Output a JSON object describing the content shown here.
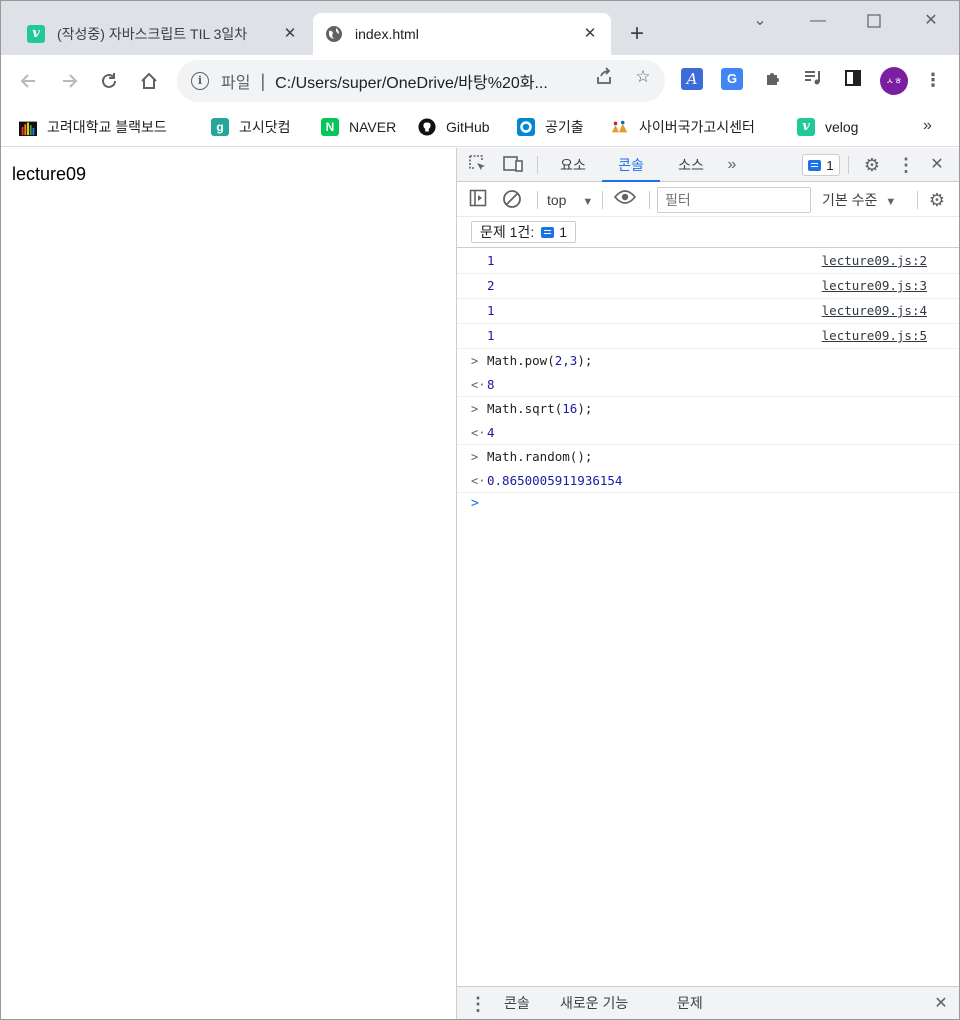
{
  "browser": {
    "tabs": [
      {
        "title": "(작성중) 자바스크립트 TIL 3일차",
        "favicon": "velog-icon",
        "active": false
      },
      {
        "title": "index.html",
        "favicon": "globe-icon",
        "active": true
      }
    ],
    "omnibox": {
      "scheme_label": "파일",
      "url": "C:/Users/super/OneDrive/바탕%20화..."
    },
    "avatar_text": "ㅅㅎ",
    "bookmarks": [
      {
        "label": "고려대학교 블랙보드",
        "icon": "bars-icon"
      },
      {
        "label": "고시닷컴",
        "icon": "g-icon"
      },
      {
        "label": "NAVER",
        "icon": "naver-icon"
      },
      {
        "label": "GitHub",
        "icon": "github-icon"
      },
      {
        "label": "공기출",
        "icon": "ring-icon"
      },
      {
        "label": "사이버국가고시센터",
        "icon": "flag-icon"
      },
      {
        "label": "velog",
        "icon": "velog-icon"
      }
    ],
    "bookmarks_more": "»"
  },
  "page": {
    "heading": "lecture09"
  },
  "devtools": {
    "tabs": [
      {
        "label": "요소",
        "active": false
      },
      {
        "label": "콘솔",
        "active": true
      },
      {
        "label": "소스",
        "active": false
      }
    ],
    "issue_count": "1",
    "context": "top",
    "filter_placeholder": "필터",
    "level": "기본 수준",
    "issues_label": "문제 1건:",
    "issues_count": "1",
    "logs": [
      {
        "value": "1",
        "source": "lecture09.js:2"
      },
      {
        "value": "2",
        "source": "lecture09.js:3"
      },
      {
        "value": "1",
        "source": "lecture09.js:4"
      },
      {
        "value": "1",
        "source": "lecture09.js:5"
      }
    ],
    "evaluations": [
      {
        "fn": "Math.pow(",
        "args": "2,3",
        "close": ");",
        "result": "8"
      },
      {
        "fn": "Math.sqrt(",
        "args": "16",
        "close": ");",
        "result": "4"
      },
      {
        "fn": "Math.random(",
        "args": "",
        "close": ");",
        "result": "0.8650005911936154"
      }
    ],
    "drawer_tabs": [
      "콘솔",
      "새로운 기능",
      "문제"
    ]
  }
}
